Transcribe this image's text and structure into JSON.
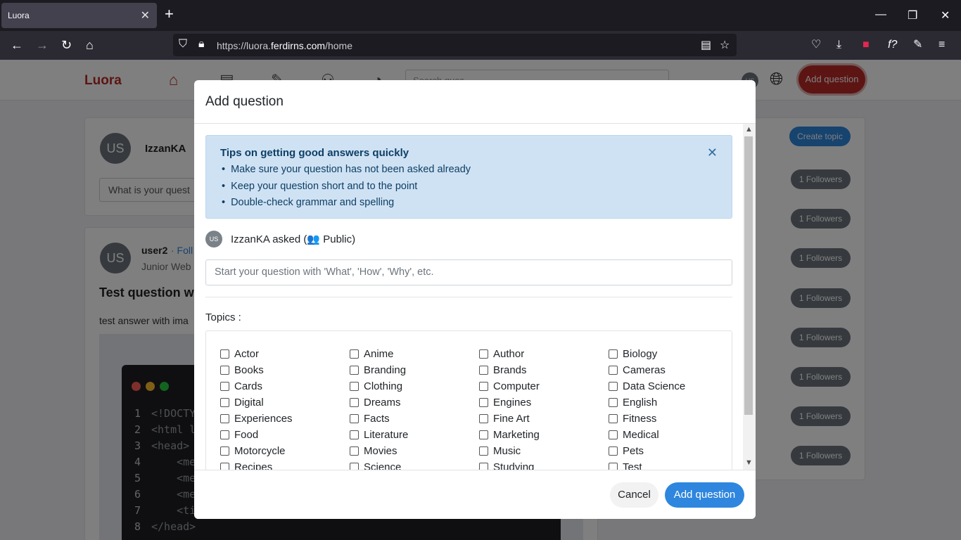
{
  "browser": {
    "tab_title": "Luora",
    "tab_close": "✕",
    "new_tab": "+",
    "url_prefix": "https://luora.",
    "url_domain": "ferdirns.com",
    "url_path": "/home",
    "window_controls": [
      "—",
      "❐",
      "✕"
    ]
  },
  "app": {
    "logo": "Luora",
    "search_placeholder": "Search ques",
    "avatar_initials": "US",
    "add_question_label": "Add question"
  },
  "feed": {
    "composer_user": "IzzanKA",
    "composer_avatar": "US",
    "composer_placeholder": "What is your quest",
    "post_user": "user2",
    "post_follow": "· Foll",
    "post_role": "Junior Web",
    "post_avatar": "US",
    "post_title": "Test question w",
    "post_answer": "test answer with ima",
    "code_lines": [
      {
        "n": "1",
        "t": "<!DOCTYP"
      },
      {
        "n": "2",
        "t": "<html la"
      },
      {
        "n": "3",
        "t": "<head>"
      },
      {
        "n": "4",
        "t": "    <met"
      },
      {
        "n": "5",
        "t": "    <met"
      },
      {
        "n": "6",
        "t": "    <met"
      },
      {
        "n": "7",
        "t": "    <tit"
      },
      {
        "n": "8",
        "t": "</head>"
      }
    ]
  },
  "sidebar": {
    "create_topic": "Create topic",
    "followers": [
      "1 Followers",
      "1 Followers",
      "1 Followers",
      "1 Followers",
      "1 Followers",
      "1 Followers",
      "1 Followers",
      "1 Followers"
    ]
  },
  "modal": {
    "title": "Add question",
    "tips_title": "Tips on getting good answers quickly",
    "tips": [
      "Make sure your question has not been asked already",
      "Keep your question short and to the point",
      "Double-check grammar and spelling"
    ],
    "tips_close": "✕",
    "asker_avatar": "US",
    "asker_text": "IzzanKA asked (👥 Public)",
    "question_placeholder": "Start your question with 'What', 'How', 'Why', etc.",
    "topics_label": "Topics :",
    "topics": [
      "Actor",
      "Anime",
      "Author",
      "Biology",
      "Books",
      "Branding",
      "Brands",
      "Cameras",
      "Cards",
      "Clothing",
      "Computer",
      "Data Science",
      "Digital",
      "Dreams",
      "Engines",
      "English",
      "Experiences",
      "Facts",
      "Fine Art",
      "Fitness",
      "Food",
      "Literature",
      "Marketing",
      "Medical",
      "Motorcycle",
      "Movies",
      "Music",
      "Pets",
      "Recipes",
      "Science",
      "Studying",
      "Test"
    ],
    "cancel_label": "Cancel",
    "submit_label": "Add question"
  }
}
